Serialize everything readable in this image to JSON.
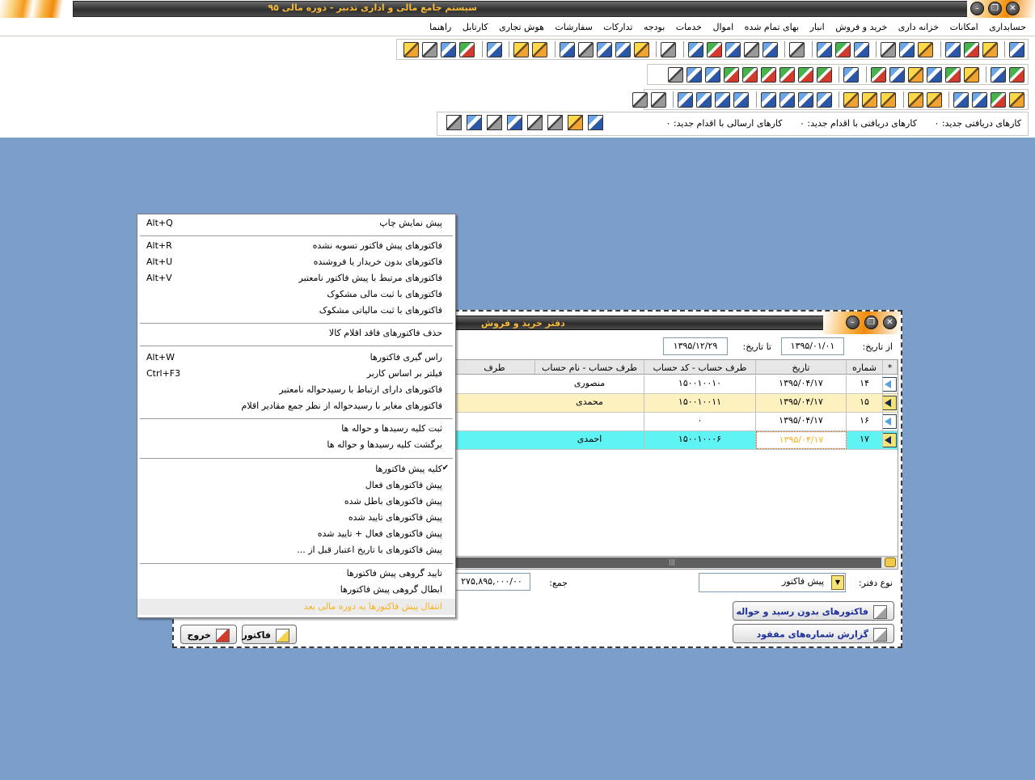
{
  "window": {
    "title": "سیستم جامع مالی و اداری تدبیر - دوره مالی ۹۵"
  },
  "menu": [
    "حسابداری",
    "امکانات",
    "خزانه داری",
    "خرید و فروش",
    "انبار",
    "بهای تمام شده",
    "اموال",
    "خدمات",
    "بودجه",
    "تدارکات",
    "سفارشات",
    "هوش تجاری",
    "کارتابل",
    "راهنما"
  ],
  "status": {
    "received_new": "کارهای دریافتی جدید: ۰",
    "received_action": "کارهای دریافتی با اقدام جدید: ۰",
    "sent_action": "کارهای ارسالی با اقدام جدید: ۰"
  },
  "dialog": {
    "title": "دفتر خرید و فروش",
    "from_date_label": "از تاریخ:",
    "from_date": "۱۳۹۵/۰۱/۰۱",
    "to_date_label": "تا تاریخ:",
    "to_date": "۱۳۹۵/۱۲/۲۹",
    "columns": [
      "شماره",
      "تاریخ",
      "طرف حساب - کد حساب",
      "طرف حساب - نام حساب",
      "طرف"
    ],
    "rows": [
      {
        "number": "۱۴",
        "date": "۱۳۹۵/۰۴/۱۷",
        "code": "۱۵۰۰۱۰۰۱۰",
        "name": "منصوری"
      },
      {
        "number": "۱۵",
        "date": "۱۳۹۵/۰۴/۱۷",
        "code": "۱۵۰۰۱۰۰۱۱",
        "name": "محمدی"
      },
      {
        "number": "۱۶",
        "date": "۱۳۹۵/۰۴/۱۷",
        "code": "۰",
        "name": ""
      },
      {
        "number": "۱۷",
        "date": "۱۳۹۵/۰۴/۱۷",
        "code": "۱۵۰۰۱۰۰۰۶",
        "name": "احمدی"
      }
    ],
    "book_type_label": "نوع دفتر:",
    "book_type_value": "پیش فاکتور",
    "sum_label": "جمع:",
    "sum_value": "۲۷۵,۸۹۵,۰۰۰/۰۰",
    "btn_unreceived": "فاکتورهای بدون رسید و حواله",
    "btn_missing": "گزارش شماره‌های مفقود",
    "btn_invoice": "فاکتور",
    "btn_exit": "خروج"
  },
  "popup": {
    "items": [
      {
        "text": "پیش نمایش چاپ",
        "key": "Alt+Q"
      },
      {
        "text": "فاکتورهای پیش فاکتور تسویه نشده",
        "key": "Alt+R"
      },
      {
        "text": "فاکتورهای بدون خریدار یا فروشنده",
        "key": "Alt+U"
      },
      {
        "text": "فاکتورهای مرتبط با پیش فاکتور نامعتبر",
        "key": "Alt+V"
      },
      {
        "text": "فاکتورهای با ثبت مالی مشکوک",
        "key": ""
      },
      {
        "text": "فاکتورهای با ثبت مالیاتی مشکوک",
        "key": ""
      },
      {
        "text": "حذف فاکتورهای فاقد اقلام کالا",
        "key": ""
      },
      {
        "text": "راس گیری فاکتورها",
        "key": "Alt+W"
      },
      {
        "text": "فیلتر بر اساس کاربر",
        "key": "Ctrl+F3"
      },
      {
        "text": "فاکتورهای دارای ارتباط با رسیدحواله نامعتبر",
        "key": ""
      },
      {
        "text": "فاکتورهای مغایر با رسیدحواله از نظر جمع مقادیر اقلام",
        "key": ""
      },
      {
        "text": "ثبت کلیه رسیدها و حواله ها",
        "key": ""
      },
      {
        "text": "برگشت کلیه رسیدها و حواله ها",
        "key": ""
      },
      {
        "text": "کلیه پیش فاکتورها",
        "key": ""
      },
      {
        "text": "پیش فاکتورهای فعال",
        "key": ""
      },
      {
        "text": "پیش فاکتورهای باطل شده",
        "key": ""
      },
      {
        "text": "پیش فاکتورهای تایید شده",
        "key": ""
      },
      {
        "text": "پیش فاکتورهای فعال + تایید شده",
        "key": ""
      },
      {
        "text": "پیش فاکتورهای با تاریخ اعتبار قبل از ...",
        "key": ""
      },
      {
        "text": "تایید گروهی پیش فاکتورها",
        "key": ""
      },
      {
        "text": "ابطال گروهی پیش فاکتورها",
        "key": ""
      },
      {
        "text": "انتقال پیش فاکتورها به دوره مالی بعد",
        "key": ""
      }
    ],
    "checkmark": "✔"
  },
  "colors": {
    "desktop": "#7b9fc9",
    "row_yellow": "#fdf1c0",
    "row_cyan": "#5ff3f3",
    "disabled_text": "#f7b21e"
  }
}
